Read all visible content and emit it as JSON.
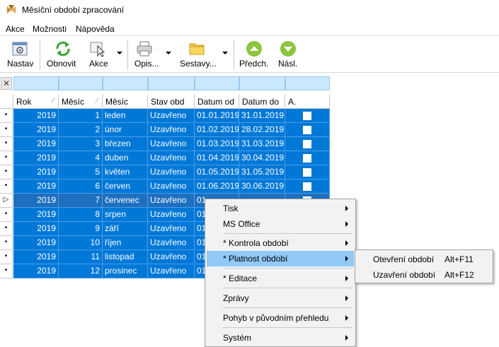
{
  "window": {
    "title": "Měsíční období zpracování"
  },
  "menu": [
    "Akce",
    "Možnosti",
    "Nápověda"
  ],
  "toolbar": {
    "nastav": "Nastav",
    "obnovit": "Obnovit",
    "akce": "Akce",
    "opis": "Opis...",
    "sestavy": "Sestavy...",
    "predch": "Předch.",
    "nasl": "Násl."
  },
  "table": {
    "columns": [
      "Rok",
      "Měsíc",
      "Měsíc",
      "Stav obd",
      "Datum od",
      "Datum do",
      "A."
    ],
    "rows": [
      {
        "rok": "2019",
        "mesic": "1",
        "nazev": "leden",
        "stav": "Uzavřeno",
        "od": "01.01.2019",
        "do": "31.01.2019"
      },
      {
        "rok": "2019",
        "mesic": "2",
        "nazev": "únor",
        "stav": "Uzavřeno",
        "od": "01.02.2019",
        "do": "28.02.2019"
      },
      {
        "rok": "2019",
        "mesic": "3",
        "nazev": "březen",
        "stav": "Uzavřeno",
        "od": "01.03.2019",
        "do": "31.03.2019"
      },
      {
        "rok": "2019",
        "mesic": "4",
        "nazev": "duben",
        "stav": "Uzavřeno",
        "od": "01.04.2019",
        "do": "30.04.2019"
      },
      {
        "rok": "2019",
        "mesic": "5",
        "nazev": "květen",
        "stav": "Uzavřeno",
        "od": "01.05.2019",
        "do": "31.05.2019"
      },
      {
        "rok": "2019",
        "mesic": "6",
        "nazev": "červen",
        "stav": "Uzavřeno",
        "od": "01.06.2019",
        "do": "30.06.2019"
      },
      {
        "rok": "2019",
        "mesic": "7",
        "nazev": "červenec",
        "stav": "Uzavřeno",
        "od": "01",
        "do": ""
      },
      {
        "rok": "2019",
        "mesic": "8",
        "nazev": "srpen",
        "stav": "Uzavřeno",
        "od": "01",
        "do": ""
      },
      {
        "rok": "2019",
        "mesic": "9",
        "nazev": "září",
        "stav": "Uzavřeno",
        "od": "01",
        "do": ""
      },
      {
        "rok": "2019",
        "mesic": "10",
        "nazev": "říjen",
        "stav": "Uzavřeno",
        "od": "01",
        "do": ""
      },
      {
        "rok": "2019",
        "mesic": "11",
        "nazev": "listopad",
        "stav": "Uzavřeno",
        "od": "01",
        "do": ""
      },
      {
        "rok": "2019",
        "mesic": "12",
        "nazev": "prosinec",
        "stav": "Uzavřeno",
        "od": "01",
        "do": ""
      }
    ]
  },
  "context_menu": {
    "items": [
      "Tisk",
      "MS Office",
      "* Kontrola období",
      "* Platnost období",
      "* Editace",
      "Zprávy",
      "Pohyb v původním přehledu",
      "Systém"
    ]
  },
  "submenu": {
    "items": [
      {
        "label": "Otevření období",
        "shortcut": "Alt+F11"
      },
      {
        "label": "Uzavření období",
        "shortcut": "Alt+F12"
      }
    ]
  },
  "colors": {
    "selection": "#0078d7",
    "menu_highlight": "#91c9f7",
    "filter_cell": "#cce8ff"
  }
}
